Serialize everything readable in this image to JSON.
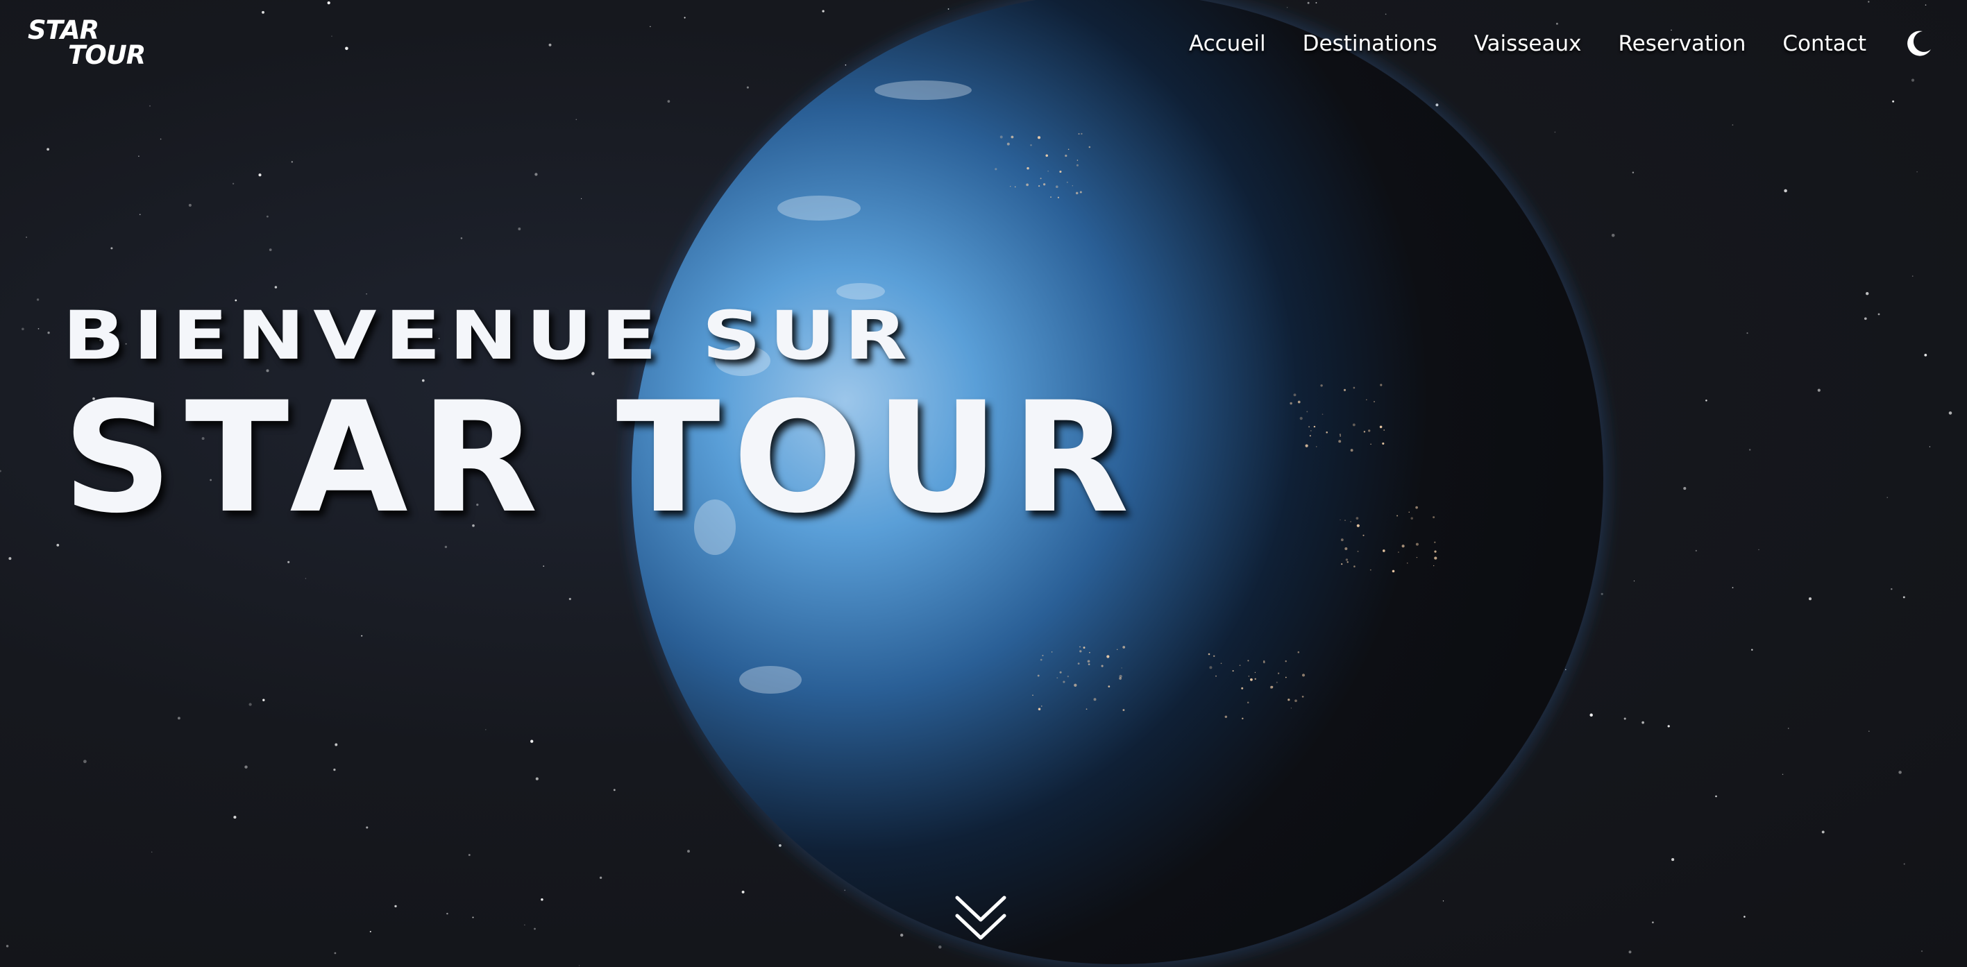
{
  "logo": {
    "line1": "STAR",
    "line2": "TOUR"
  },
  "nav": {
    "items": [
      {
        "label": "Accueil"
      },
      {
        "label": "Destinations"
      },
      {
        "label": "Vaisseaux"
      },
      {
        "label": "Reservation"
      },
      {
        "label": "Contact"
      }
    ],
    "theme_toggle_icon": "moon-icon"
  },
  "hero": {
    "title_line1": "BIENVENUE SUR",
    "title_line2": "STAR TOUR",
    "scroll_icon": "double-chevron-down-icon"
  },
  "colors": {
    "background": "#141519",
    "planet": "#4a8fd0",
    "text": "#ffffff"
  }
}
